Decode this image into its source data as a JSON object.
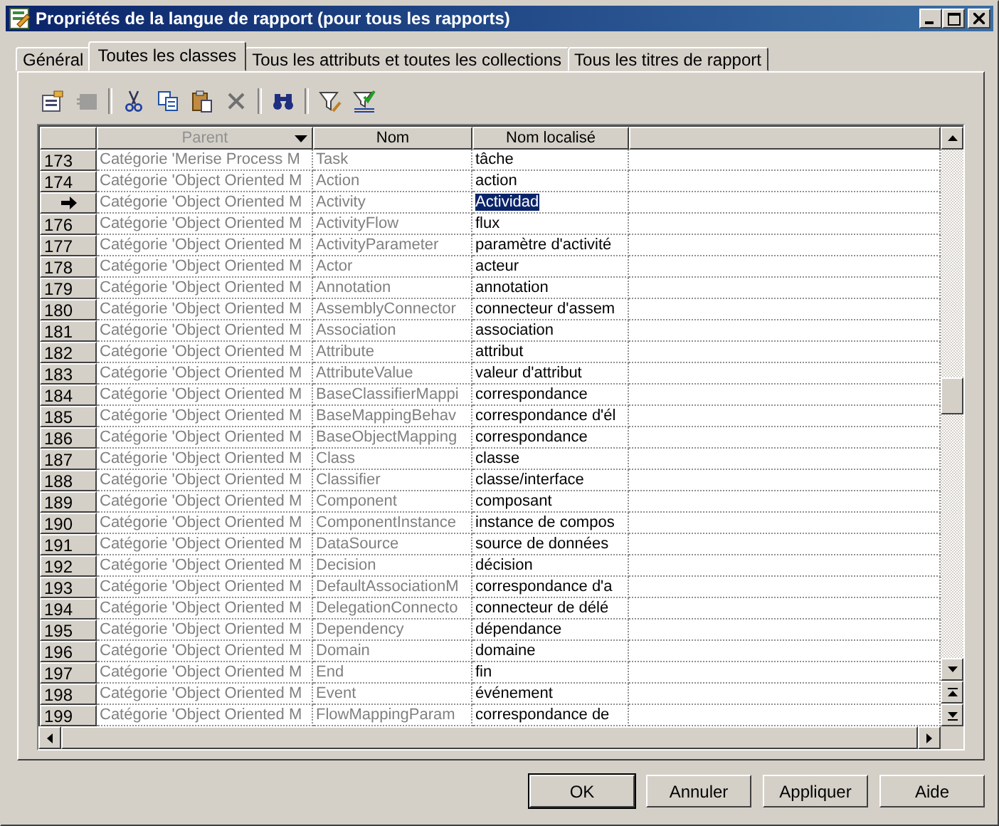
{
  "window": {
    "title": "Propriétés de la langue de rapport (pour tous les rapports)"
  },
  "tabs": [
    {
      "label": "Général",
      "selected": false
    },
    {
      "label": "Toutes les classes",
      "selected": true
    },
    {
      "label": "Tous les attributs et toutes les collections",
      "selected": false
    },
    {
      "label": "Tous les titres de rapport",
      "selected": false
    }
  ],
  "toolbar": [
    {
      "kind": "properties",
      "disabled": false
    },
    {
      "kind": "grid",
      "disabled": true
    },
    {
      "kind": "sep"
    },
    {
      "kind": "cut",
      "disabled": false
    },
    {
      "kind": "copy",
      "disabled": false
    },
    {
      "kind": "paste",
      "disabled": false
    },
    {
      "kind": "delete",
      "disabled": false
    },
    {
      "kind": "sep"
    },
    {
      "kind": "find",
      "disabled": false
    },
    {
      "kind": "sep"
    },
    {
      "kind": "filter",
      "disabled": false
    },
    {
      "kind": "filter-check",
      "disabled": false
    }
  ],
  "table": {
    "columns": [
      {
        "label": "Parent",
        "dropdown": true,
        "dimmed": true
      },
      {
        "label": "Nom",
        "dropdown": false,
        "dimmed": false
      },
      {
        "label": "Nom localisé",
        "dropdown": false,
        "dimmed": false
      }
    ],
    "rows": [
      {
        "number": "173",
        "parent": "Catégorie 'Merise Process M",
        "name": "Task",
        "localized": "tâche",
        "selected": false
      },
      {
        "number": "174",
        "parent": "Catégorie 'Object Oriented M",
        "name": "Action",
        "localized": "action",
        "selected": false
      },
      {
        "parent": "Catégorie 'Object Oriented M",
        "name": "Activity",
        "localized": "Actividad",
        "selected": true
      },
      {
        "number": "176",
        "parent": "Catégorie 'Object Oriented M",
        "name": "ActivityFlow",
        "localized": "flux",
        "selected": false
      },
      {
        "number": "177",
        "parent": "Catégorie 'Object Oriented M",
        "name": "ActivityParameter",
        "localized": "paramètre d'activité",
        "selected": false
      },
      {
        "number": "178",
        "parent": "Catégorie 'Object Oriented M",
        "name": "Actor",
        "localized": "acteur",
        "selected": false
      },
      {
        "number": "179",
        "parent": "Catégorie 'Object Oriented M",
        "name": "Annotation",
        "localized": "annotation",
        "selected": false
      },
      {
        "number": "180",
        "parent": "Catégorie 'Object Oriented M",
        "name": "AssemblyConnector",
        "localized": "connecteur d'assem",
        "selected": false
      },
      {
        "number": "181",
        "parent": "Catégorie 'Object Oriented M",
        "name": "Association",
        "localized": "association",
        "selected": false
      },
      {
        "number": "182",
        "parent": "Catégorie 'Object Oriented M",
        "name": "Attribute",
        "localized": "attribut",
        "selected": false
      },
      {
        "number": "183",
        "parent": "Catégorie 'Object Oriented M",
        "name": "AttributeValue",
        "localized": "valeur d'attribut",
        "selected": false
      },
      {
        "number": "184",
        "parent": "Catégorie 'Object Oriented M",
        "name": "BaseClassifierMappi",
        "localized": "correspondance",
        "selected": false
      },
      {
        "number": "185",
        "parent": "Catégorie 'Object Oriented M",
        "name": "BaseMappingBehav",
        "localized": "correspondance d'él",
        "selected": false
      },
      {
        "number": "186",
        "parent": "Catégorie 'Object Oriented M",
        "name": "BaseObjectMapping",
        "localized": "correspondance",
        "selected": false
      },
      {
        "number": "187",
        "parent": "Catégorie 'Object Oriented M",
        "name": "Class",
        "localized": "classe",
        "selected": false
      },
      {
        "number": "188",
        "parent": "Catégorie 'Object Oriented M",
        "name": "Classifier",
        "localized": "classe/interface",
        "selected": false
      },
      {
        "number": "189",
        "parent": "Catégorie 'Object Oriented M",
        "name": "Component",
        "localized": "composant",
        "selected": false
      },
      {
        "number": "190",
        "parent": "Catégorie 'Object Oriented M",
        "name": "ComponentInstance",
        "localized": "instance de compos",
        "selected": false
      },
      {
        "number": "191",
        "parent": "Catégorie 'Object Oriented M",
        "name": "DataSource",
        "localized": "source de données",
        "selected": false
      },
      {
        "number": "192",
        "parent": "Catégorie 'Object Oriented M",
        "name": "Decision",
        "localized": "décision",
        "selected": false
      },
      {
        "number": "193",
        "parent": "Catégorie 'Object Oriented M",
        "name": "DefaultAssociationM",
        "localized": "correspondance d'a",
        "selected": false
      },
      {
        "number": "194",
        "parent": "Catégorie 'Object Oriented M",
        "name": "DelegationConnecto",
        "localized": "connecteur de délé",
        "selected": false
      },
      {
        "number": "195",
        "parent": "Catégorie 'Object Oriented M",
        "name": "Dependency",
        "localized": "dépendance",
        "selected": false
      },
      {
        "number": "196",
        "parent": "Catégorie 'Object Oriented M",
        "name": "Domain",
        "localized": "domaine",
        "selected": false
      },
      {
        "number": "197",
        "parent": "Catégorie 'Object Oriented M",
        "name": "End",
        "localized": "fin",
        "selected": false
      },
      {
        "number": "198",
        "parent": "Catégorie 'Object Oriented M",
        "name": "Event",
        "localized": "événement",
        "selected": false
      },
      {
        "number": "199",
        "parent": "Catégorie 'Object Oriented M",
        "name": "FlowMappingParam",
        "localized": "correspondance de",
        "selected": false
      }
    ]
  },
  "buttons": [
    {
      "label": "OK",
      "default": true
    },
    {
      "label": "Annuler",
      "default": false
    },
    {
      "label": "Appliquer",
      "default": false
    },
    {
      "label": "Aide",
      "default": false
    }
  ]
}
